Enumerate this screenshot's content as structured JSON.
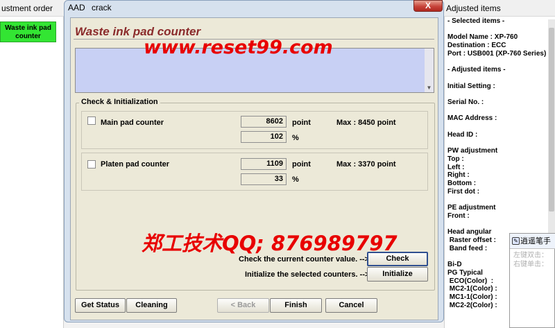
{
  "left_pane": {
    "title": "ustment order",
    "selected_item": "Waste ink pad\ncounter"
  },
  "dialog": {
    "title_bar": "AAD  crack",
    "close_symbol": "X",
    "heading": "Waste ink pad counter",
    "watermark_url": "www.reset99.com",
    "watermark_qq": "郑工技术QQ; 876989797",
    "group_label": "Check & Initialization",
    "counters": [
      {
        "label": "Main pad counter",
        "point_value": "8602",
        "point_unit": "point",
        "max": "Max : 8450 point",
        "percent_value": "102",
        "percent_unit": "%"
      },
      {
        "label": "Platen pad counter",
        "point_value": "1109",
        "point_unit": "point",
        "max": "Max : 3370 point",
        "percent_value": "33",
        "percent_unit": "%"
      }
    ],
    "check_hint": "Check the current counter value. -->",
    "check_label": "Check",
    "init_hint": "Initialize the selected counters. -->",
    "init_label": "Initialize",
    "footer": {
      "get_status": "Get Status",
      "cleaning": "Cleaning",
      "back": "< Back",
      "finish": "Finish",
      "cancel": "Cancel"
    }
  },
  "right_pane": {
    "title": "Adjusted items",
    "info_text": "- Selected items -\n\nModel Name : XP-760\nDestination : ECC\nPort : USB001 (XP-760 Series)\n\n- Adjusted items -\n\nInitial Setting :\n\nSerial No. :\n\nMAC Address :\n\nHead ID :\n\nPW adjustment\nTop :\nLeft :\nRight :\nBottom :\nFirst dot :\n\nPE adjustment\nFront :\n\nHead angular\n Raster offset :\n Band feed :\n\nBi-D\nPG Typical\n ECO(Color)  :\n MC2-1(Color) :\n MC1-1(Color) :\n MC2-2(Color) :"
  },
  "popup": {
    "title": "逍遥笔手",
    "text": "左键双击：\n右键单击："
  }
}
